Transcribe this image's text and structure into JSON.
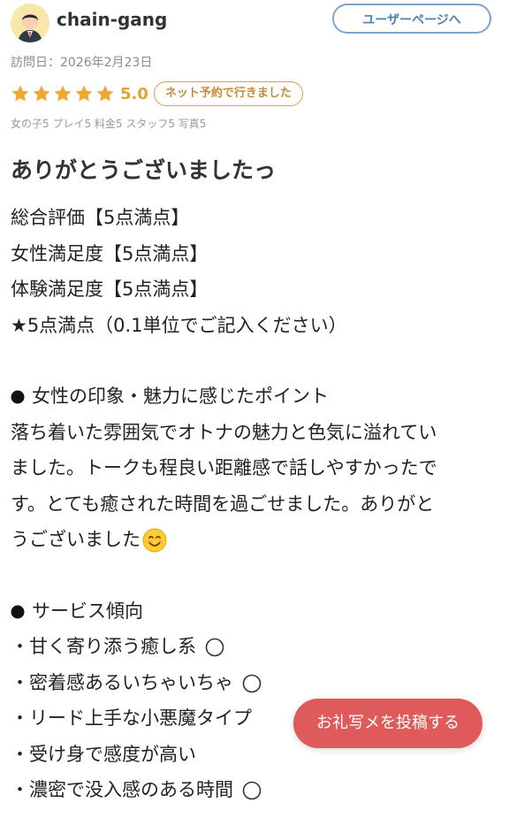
{
  "header": {
    "username": "chain-gang",
    "user_page_button": "ユーザーページへ"
  },
  "review": {
    "visit_date": "訪問日：2026年2月23日",
    "rating": {
      "stars": 5,
      "score": "5.0",
      "badge": "ネット予約で行きました"
    },
    "sub_ratings": "女の子5 プレイ5 料金5 スタッフ5 写真5",
    "title": "ありがとうございましたっ",
    "body": {
      "line1": "総合評価【5点満点】",
      "line2": "女性満足度【5点満点】",
      "line3": "体験満足度【5点満点】",
      "line4": "★5点満点（0.1単位でご記入ください）",
      "impression_heading": "女性の印象・魅力に感じたポイント",
      "impression_l1": "落ち着いた雰囲気でオトナの魅力と色気に溢れてい",
      "impression_l2": "ました。トークも程良い距離感で話しやすかったで",
      "impression_l3": "す。とても癒された時間を過ごせました。ありがと",
      "impression_l4": "うございました",
      "service_heading": "サービス傾向",
      "service_items": [
        "・甘く寄り添う癒し系",
        "・密着感あるいちゃいちゃ",
        "・リード上手な小悪魔タイプ",
        "・受け身で感度が高い",
        "・濃密で没入感のある時間"
      ]
    }
  },
  "floating_button": {
    "label": "お礼写メを投稿する"
  },
  "colors": {
    "star": "#f0a830",
    "badge_border": "#d8a04a",
    "user_button": "#7fa3c9",
    "fab": "#df5b5b"
  }
}
